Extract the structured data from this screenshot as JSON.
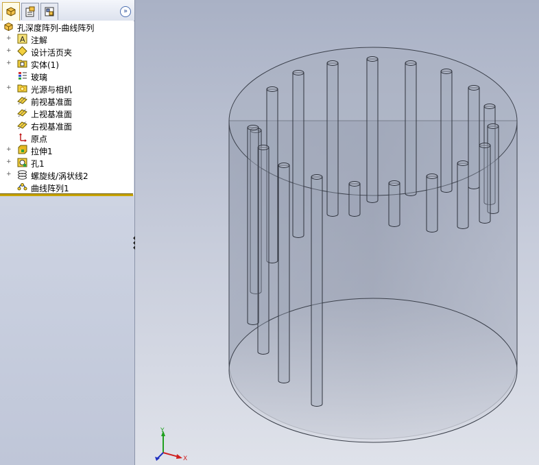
{
  "feature_tree": {
    "root": {
      "label": "孔深度阵列-曲线阵列",
      "icon": "part-icon"
    },
    "items": [
      {
        "label": "注解",
        "icon": "annotations-icon",
        "expandable": true
      },
      {
        "label": "设计活页夹",
        "icon": "design-binder-icon",
        "expandable": true
      },
      {
        "label": "实体(1)",
        "icon": "solid-bodies-icon",
        "expandable": true
      },
      {
        "label": "玻璃",
        "icon": "material-icon",
        "expandable": false
      },
      {
        "label": "光源与相机",
        "icon": "lights-cameras-icon",
        "expandable": true
      },
      {
        "label": "前视基准面",
        "icon": "plane-icon",
        "expandable": false
      },
      {
        "label": "上视基准面",
        "icon": "plane-icon",
        "expandable": false
      },
      {
        "label": "右视基准面",
        "icon": "plane-icon",
        "expandable": false
      },
      {
        "label": "原点",
        "icon": "origin-icon",
        "expandable": false
      },
      {
        "label": "拉伸1",
        "icon": "extrude-icon",
        "expandable": true
      },
      {
        "label": "孔1",
        "icon": "hole-icon",
        "expandable": true
      },
      {
        "label": "螺旋线/涡状线2",
        "icon": "helix-icon",
        "expandable": true
      },
      {
        "label": "曲线阵列1",
        "icon": "curve-pattern-icon",
        "expandable": false
      }
    ],
    "expand_glyph": "+"
  },
  "panel_tabs": [
    {
      "name": "featuremanager-tab",
      "active": true
    },
    {
      "name": "propertymanager-tab",
      "active": false
    },
    {
      "name": "configurationmanager-tab",
      "active": false
    }
  ],
  "panel_expand_glyph": "»",
  "triad": {
    "x_label": "X",
    "y_label": "Y"
  },
  "colors": {
    "rollback_bar": "#c8a400",
    "panel_bg": "#cdd3e2",
    "viewport_top": "#a9b1c5",
    "axis_x": "#d02020",
    "axis_y": "#20a020",
    "axis_z": "#2030c0"
  }
}
